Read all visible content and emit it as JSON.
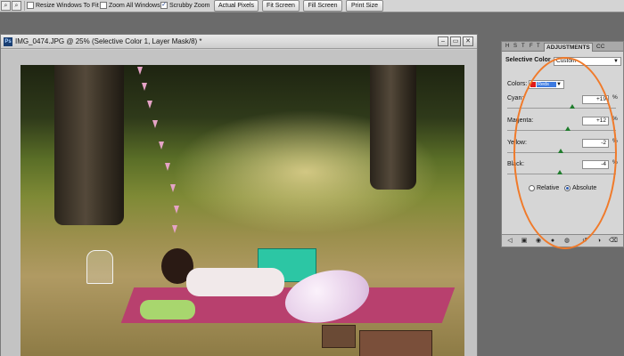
{
  "options_bar": {
    "checkboxes": [
      {
        "label": "Resize Windows To Fit",
        "checked": false
      },
      {
        "label": "Zoom All Windows",
        "checked": false
      },
      {
        "label": "Scrubby Zoom",
        "checked": true
      }
    ],
    "buttons": [
      "Actual Pixels",
      "Fit Screen",
      "Fill Screen",
      "Print Size"
    ]
  },
  "document": {
    "title": "IMG_0474.JPG @ 25% (Selective Color 1, Layer Mask/8) *",
    "app_badge": "Ps"
  },
  "panel": {
    "tabs": [
      {
        "label": "ADJUSTMENTS",
        "active": true
      },
      {
        "label": "CC",
        "active": false
      }
    ],
    "title": "Selective Color",
    "preset": "Custom",
    "colors_label": "Colors:",
    "colors_value": "Reds",
    "colors_swatch": "#e01a1a",
    "rows": [
      {
        "label": "Cyan:",
        "value": "+19",
        "unit": "%",
        "level": 0.595
      },
      {
        "label": "Magenta:",
        "value": "+12",
        "unit": "%",
        "level": 0.56
      },
      {
        "label": "Yellow:",
        "value": "-2",
        "unit": "%",
        "level": 0.49
      },
      {
        "label": "Black:",
        "value": "-4",
        "unit": "%",
        "level": 0.48
      }
    ],
    "method": {
      "options": [
        {
          "label": "Relative",
          "selected": false
        },
        {
          "label": "Absolute",
          "selected": true
        }
      ]
    }
  },
  "annotation_color": "#f07a2a"
}
